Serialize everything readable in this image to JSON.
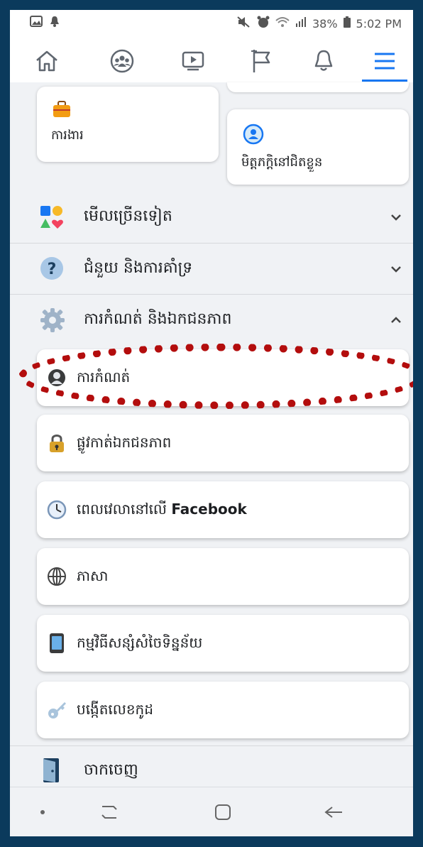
{
  "status_bar": {
    "battery": "38%",
    "time": "5:02 PM",
    "icons": [
      "image-icon",
      "notification-bell-icon",
      "mute-icon",
      "alarm-icon",
      "wifi-icon",
      "signal-icon",
      "battery-icon"
    ]
  },
  "nav": {
    "tabs": [
      "home-icon",
      "groups-icon",
      "watch-icon",
      "pages-icon",
      "notifications-icon",
      "menu-icon"
    ],
    "active": "menu-icon",
    "accent": "#1877f2"
  },
  "shortcuts": {
    "jobs_label": "ការងារ",
    "nearby_friends_label": "មិត្តភក្តិនៅជិតខ្លួន"
  },
  "sections": {
    "see_more": "មើលច្រើនទៀត",
    "help_support": "ជំនួយ និងការគាំទ្រ",
    "settings_privacy": "ការកំណត់ និងឯកជនភាព"
  },
  "settings_items": {
    "settings": "ការកំណត់",
    "privacy_shortcuts": "ផ្លូវកាត់ឯកជនភាព",
    "time_on_facebook_prefix": "ពេលវេលានៅលើ ",
    "time_on_facebook_brand": "Facebook",
    "language": "ភាសា",
    "data_saver": "កម្មវិធីសន្សំសំចៃទិន្នន័យ",
    "code_generator": "បង្កើតលេខកូដ"
  },
  "logout_label": "ចាកចេញ",
  "highlight_color": "#b30d0d"
}
